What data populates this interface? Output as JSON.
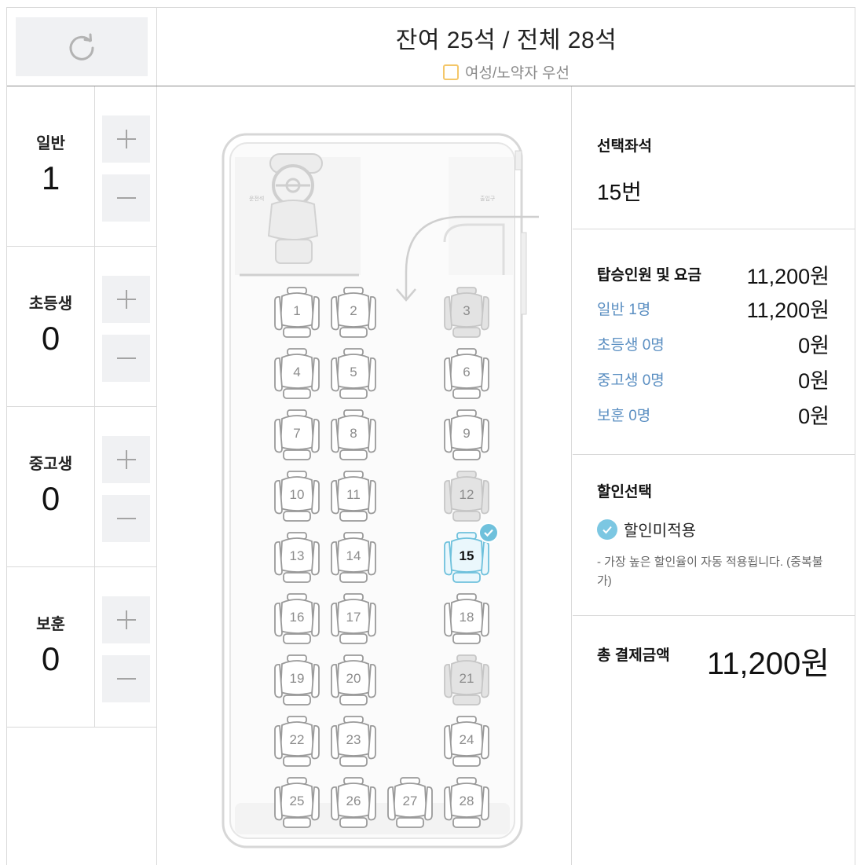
{
  "header": {
    "refresh_icon": "refresh-icon",
    "remaining_text": "잔여 25석 / 전체 28석",
    "priority_label": "여성/노약자 우선",
    "priority_color": "#f4c76a"
  },
  "counters": [
    {
      "label": "일반",
      "count": "1"
    },
    {
      "label": "초등생",
      "count": "0"
    },
    {
      "label": "중고생",
      "count": "0"
    },
    {
      "label": "보훈",
      "count": "0"
    }
  ],
  "bus": {
    "driver_label": "운전석",
    "door_label": "출입구",
    "seats": [
      {
        "no": "1",
        "state": "available"
      },
      {
        "no": "2",
        "state": "available"
      },
      {
        "no": "3",
        "state": "sold"
      },
      {
        "no": "4",
        "state": "available"
      },
      {
        "no": "5",
        "state": "available"
      },
      {
        "no": "6",
        "state": "available"
      },
      {
        "no": "7",
        "state": "available"
      },
      {
        "no": "8",
        "state": "available"
      },
      {
        "no": "9",
        "state": "available"
      },
      {
        "no": "10",
        "state": "available"
      },
      {
        "no": "11",
        "state": "available"
      },
      {
        "no": "12",
        "state": "sold"
      },
      {
        "no": "13",
        "state": "available"
      },
      {
        "no": "14",
        "state": "available"
      },
      {
        "no": "15",
        "state": "selected"
      },
      {
        "no": "16",
        "state": "available"
      },
      {
        "no": "17",
        "state": "available"
      },
      {
        "no": "18",
        "state": "available"
      },
      {
        "no": "19",
        "state": "available"
      },
      {
        "no": "20",
        "state": "available"
      },
      {
        "no": "21",
        "state": "sold"
      },
      {
        "no": "22",
        "state": "available"
      },
      {
        "no": "23",
        "state": "available"
      },
      {
        "no": "24",
        "state": "available"
      },
      {
        "no": "25",
        "state": "available"
      },
      {
        "no": "26",
        "state": "available"
      },
      {
        "no": "27",
        "state": "available"
      },
      {
        "no": "28",
        "state": "available"
      }
    ],
    "colors": {
      "available": "#9a9a9a",
      "sold": "#c6c6c6",
      "selected": "#6fc1dc"
    }
  },
  "panel": {
    "selected_title": "선택좌석",
    "selected_value": "15번",
    "fare_title": "탑승인원 및 요금",
    "fare_total": "11,200원",
    "fares": [
      {
        "label": "일반 1명",
        "value": "11,200원"
      },
      {
        "label": "초등생 0명",
        "value": "0원"
      },
      {
        "label": "중고생 0명",
        "value": "0원"
      },
      {
        "label": "보훈 0명",
        "value": "0원"
      }
    ],
    "discount_title": "할인선택",
    "discount_option": "할인미적용",
    "discount_note": "- 가장 높은 할인율이 자동 적용됩니다. (중복불가)",
    "total_label": "총 결제금액",
    "total_value": "11,200원"
  }
}
